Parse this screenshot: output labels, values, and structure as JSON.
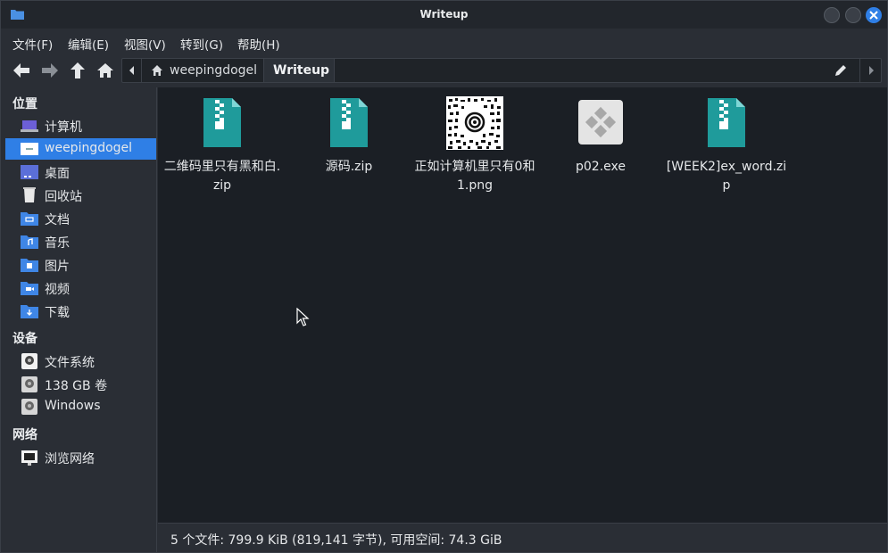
{
  "window": {
    "title": "Writeup"
  },
  "menu": [
    "文件(F)",
    "编辑(E)",
    "视图(V)",
    "转到(G)",
    "帮助(H)"
  ],
  "path": {
    "parent": "weepingdogel",
    "current": "Writeup"
  },
  "sidebar": {
    "sections": [
      {
        "title": "位置",
        "items": [
          {
            "label": "计算机",
            "icon": "computer-icon"
          },
          {
            "label": "weepingdogel",
            "icon": "home-folder-icon",
            "selected": true
          },
          {
            "label": "桌面",
            "icon": "desktop-icon"
          },
          {
            "label": "回收站",
            "icon": "trash-icon"
          },
          {
            "label": "文档",
            "icon": "documents-folder-icon"
          },
          {
            "label": "音乐",
            "icon": "music-folder-icon"
          },
          {
            "label": "图片",
            "icon": "pictures-folder-icon"
          },
          {
            "label": "视频",
            "icon": "videos-folder-icon"
          },
          {
            "label": "下载",
            "icon": "downloads-folder-icon"
          }
        ]
      },
      {
        "title": "设备",
        "items": [
          {
            "label": "文件系统",
            "icon": "drive-icon"
          },
          {
            "label": "138 GB 卷",
            "icon": "drive-icon"
          },
          {
            "label": "Windows",
            "icon": "drive-icon"
          }
        ]
      },
      {
        "title": "网络",
        "items": [
          {
            "label": "浏览网络",
            "icon": "network-icon"
          }
        ]
      }
    ]
  },
  "files": [
    {
      "name": "二维码里只有黑和白.zip",
      "type": "zip",
      "icon": "zip-archive-icon"
    },
    {
      "name": "源码.zip",
      "type": "zip",
      "icon": "zip-archive-icon"
    },
    {
      "name": "正如计算机里只有0和1.png",
      "type": "image",
      "icon": "qr-image-thumbnail"
    },
    {
      "name": "p02.exe",
      "type": "exe",
      "icon": "executable-icon"
    },
    {
      "name": "[WEEK2]ex_word.zip",
      "type": "zip",
      "icon": "zip-archive-icon"
    }
  ],
  "status": "5 个文件: 799.9 KiB (819,141 字节), 可用空间: 74.3 GiB",
  "colors": {
    "accent": "#2f7fe6",
    "zip": "#1f9b9b",
    "background": "#1b1f25",
    "panel": "#2a2e35"
  }
}
